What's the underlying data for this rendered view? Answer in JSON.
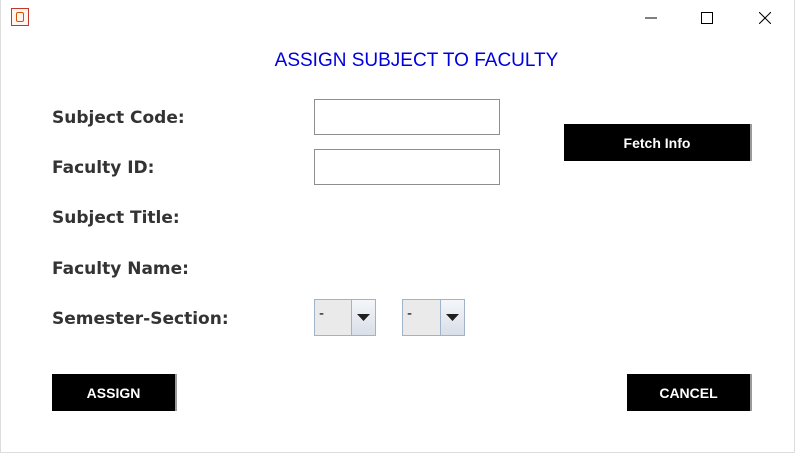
{
  "window": {
    "title": "",
    "controls": {
      "minimize": "minimize-icon",
      "maximize": "maximize-icon",
      "close": "close-icon"
    }
  },
  "form": {
    "heading": "ASSIGN SUBJECT TO FACULTY",
    "labels": {
      "subject_code": "Subject Code:",
      "faculty_id": "Faculty ID:",
      "subject_title": "Subject Title:",
      "faculty_name": "Faculty Name:",
      "semester_section": "Semester-Section:"
    },
    "fields": {
      "subject_code": "",
      "faculty_id": ""
    },
    "selects": {
      "semester": "-",
      "section": "-"
    },
    "buttons": {
      "fetch_info": "Fetch Info",
      "assign": "ASSIGN",
      "cancel": "CANCEL"
    }
  },
  "colors": {
    "heading": "#0000dd",
    "button_bg": "#000000",
    "button_text": "#ffffff",
    "label_text": "#333333"
  }
}
